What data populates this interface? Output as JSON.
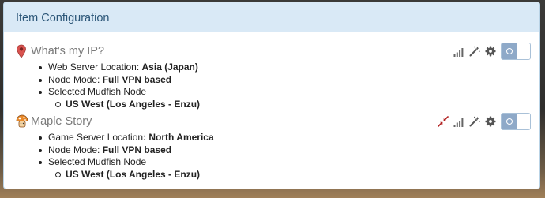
{
  "panel": {
    "title": "Item Configuration"
  },
  "items": [
    {
      "name": "What's my IP?",
      "icon": "map-pin-icon",
      "properties": [
        {
          "label": "Web Server Location:",
          "value": "Asia (Japan)"
        },
        {
          "label": "Node Mode:",
          "value": "Full VPN based"
        },
        {
          "label": "Selected Mudfish Node",
          "value": ""
        }
      ],
      "nodes": [
        "US West (Los Angeles - Enzu)"
      ],
      "actions": [
        "signal-strength-icon",
        "magic-wand-icon",
        "gear-icon"
      ],
      "enabled": true
    },
    {
      "name": "Maple Story",
      "icon": "mushroom-icon",
      "properties": [
        {
          "label": "Game Server Location",
          "value": ": North America"
        },
        {
          "label": "Node Mode:",
          "value": "Full VPN based"
        },
        {
          "label": "Selected Mudfish Node",
          "value": ""
        }
      ],
      "nodes": [
        "US West (Los Angeles - Enzu)"
      ],
      "actions": [
        "compress-arrows-icon",
        "signal-strength-icon",
        "magic-wand-icon",
        "gear-icon"
      ],
      "enabled": true
    }
  ],
  "colors": {
    "heading_bg": "#d9e9f6",
    "heading_text": "#2a5577",
    "toggle_on": "#8ea9c8",
    "compress_icon": "#b22222"
  }
}
